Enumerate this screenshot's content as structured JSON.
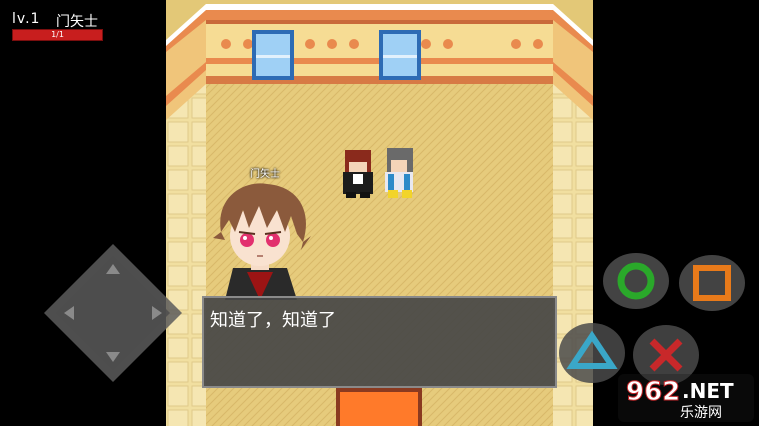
{
  "hud": {
    "level": "lv.1",
    "name": "门矢士",
    "hp_text": "1/1",
    "hp_fraction": 1.0
  },
  "speaker_tag": "门矢士",
  "dialog": {
    "text": "知道了，知道了"
  },
  "controls": {
    "dpad": "dpad",
    "circle": "circle-button",
    "square": "square-button",
    "triangle": "triangle-button",
    "cross": "cross-button"
  },
  "watermark": {
    "top": "962",
    "net": ".NET",
    "bottom": "乐游网"
  },
  "colors": {
    "hp": "#c81e1e",
    "circle": "#2aa82a",
    "square": "#e87a1a",
    "triangle": "#3aa7c8",
    "cross": "#c8282a"
  }
}
